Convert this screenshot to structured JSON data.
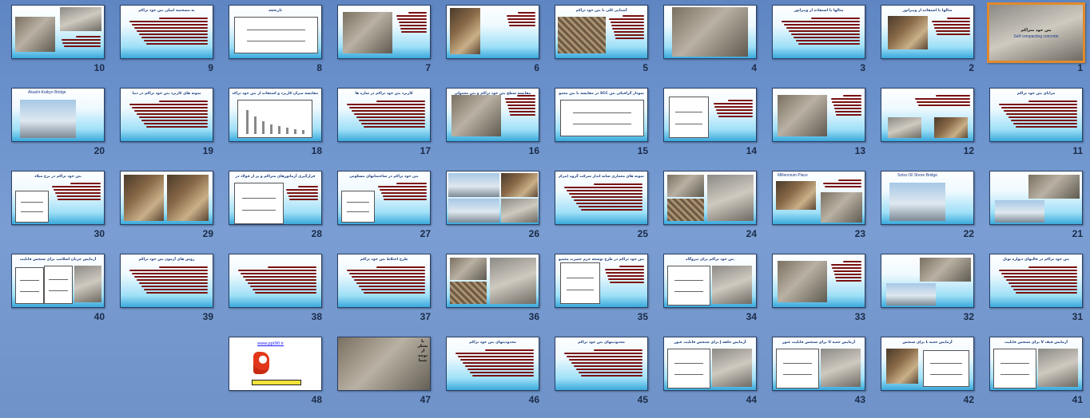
{
  "slides": [
    {
      "n": "1",
      "title": "",
      "kind": "title-photo",
      "sel": true,
      "text1": "بتن خود متراکم",
      "text2": "Self compacting concrete"
    },
    {
      "n": "2",
      "title": "مثالها یا استفاده از ویبراتور",
      "kind": "text-photo"
    },
    {
      "n": "3",
      "title": "مثالها یا استفاده از ویبراتور",
      "kind": "text"
    },
    {
      "n": "4",
      "title": "",
      "kind": "photo-full"
    },
    {
      "n": "5",
      "title": "آشنایی کلی با بتن خود تراکم",
      "kind": "text-photo-left"
    },
    {
      "n": "6",
      "title": "",
      "kind": "text-photo-left-tall"
    },
    {
      "n": "7",
      "title": "",
      "kind": "photo-text"
    },
    {
      "n": "8",
      "title": "تاریخچه",
      "kind": "diagram"
    },
    {
      "n": "9",
      "title": "به مشخصه اصلی بتن خود تراکم",
      "kind": "text"
    },
    {
      "n": "10",
      "title": "",
      "kind": "text-photo-right-top"
    },
    {
      "n": "11",
      "title": "مزایای بتن خود تراکم",
      "kind": "text"
    },
    {
      "n": "12",
      "title": "",
      "kind": "text-two-photos"
    },
    {
      "n": "13",
      "title": "",
      "kind": "photo-text"
    },
    {
      "n": "14",
      "title": "",
      "kind": "table-text"
    },
    {
      "n": "15",
      "title": "نمودار گرافیکی بتن SCC در مقایسه با بتن معمولی",
      "kind": "diagram"
    },
    {
      "n": "16",
      "title": "مقایسه سطح بتن خود تراکم و بتن معمولی",
      "kind": "photo-text"
    },
    {
      "n": "17",
      "title": "کاربرد بتن خود تراکم در سازه ها",
      "kind": "text"
    },
    {
      "n": "18",
      "title": "مقایسه میزان کاربرد و استفاده از بتن خود تراکم در کشورهای صنعتی",
      "kind": "chart"
    },
    {
      "n": "19",
      "title": "نمونه های کاربرد بتن خود تراکم در دنیا",
      "kind": "text"
    },
    {
      "n": "20",
      "title": "Akashi-Kaikyo Bridge",
      "kind": "caption-photo"
    },
    {
      "n": "21",
      "title": "",
      "kind": "two-photos"
    },
    {
      "n": "22",
      "title": "Sotra Oil Shore Bridge",
      "kind": "caption-photo"
    },
    {
      "n": "23",
      "title": "Millennium Place",
      "kind": "two-photos-caption"
    },
    {
      "n": "24",
      "title": "",
      "kind": "three-photos"
    },
    {
      "n": "25",
      "title": "نمونه های معماری سایه انداز شرکت گروه (مرکز خرید)",
      "kind": "text"
    },
    {
      "n": "26",
      "title": "",
      "kind": "photo-grid"
    },
    {
      "n": "27",
      "title": "بتن خود تراکم در ساختمانهای مسکونی",
      "kind": "text-diagram"
    },
    {
      "n": "28",
      "title": "قرارگیری آرماتورهای متراکم و پر از فولاد در",
      "kind": "diagram-text"
    },
    {
      "n": "29",
      "title": "",
      "kind": "two-photos-tall"
    },
    {
      "n": "30",
      "title": "بتن خود تراکم در برج میلاد",
      "kind": "text-diagram"
    },
    {
      "n": "31",
      "title": "بتن خود تراکم در قالبهای دیواره تونل",
      "kind": "text"
    },
    {
      "n": "32",
      "title": "",
      "kind": "two-photos"
    },
    {
      "n": "33",
      "title": "",
      "kind": "photo-text"
    },
    {
      "n": "34",
      "title": "بتن خود تراکم برای نیروگاه",
      "kind": "diagram-photo"
    },
    {
      "n": "35",
      "title": "بتن خود تراکم در طرح توسعه حرم حضرت معصومه (ع)",
      "kind": "table-text"
    },
    {
      "n": "36",
      "title": "",
      "kind": "three-photos"
    },
    {
      "n": "37",
      "title": "طرح اختلاط بتن خود تراکم",
      "kind": "text"
    },
    {
      "n": "38",
      "title": "",
      "kind": "text"
    },
    {
      "n": "39",
      "title": "روش های آزمون بتن خود تراکم",
      "kind": "text"
    },
    {
      "n": "40",
      "title": "آزمایش جریان اسلامپ برای سنجش قابلیت",
      "kind": "three-diagrams"
    },
    {
      "n": "41",
      "title": "آزمایش قیف V برای سنجش قابلیت",
      "kind": "diagram-photo"
    },
    {
      "n": "42",
      "title": "آزمایش جعبه L برای سنجش",
      "kind": "photo-diagram"
    },
    {
      "n": "43",
      "title": "آزمایش جعبه U برای سنجش قابلیت عبور",
      "kind": "diagram-photo"
    },
    {
      "n": "44",
      "title": "آزمایش حلقه J برای سنجش قابلیت عبور",
      "kind": "diagram-photo"
    },
    {
      "n": "45",
      "title": "محدودیتهای بتن خود تراکم",
      "kind": "text"
    },
    {
      "n": "46",
      "title": "محدودیتهای بتن خود تراکم",
      "kind": "text"
    },
    {
      "n": "47",
      "title": "",
      "kind": "photo-end",
      "endtext": "با تشکر از توجه شما"
    },
    {
      "n": "48",
      "title": "",
      "kind": "promo",
      "link": "www.ppt90.ir"
    }
  ]
}
